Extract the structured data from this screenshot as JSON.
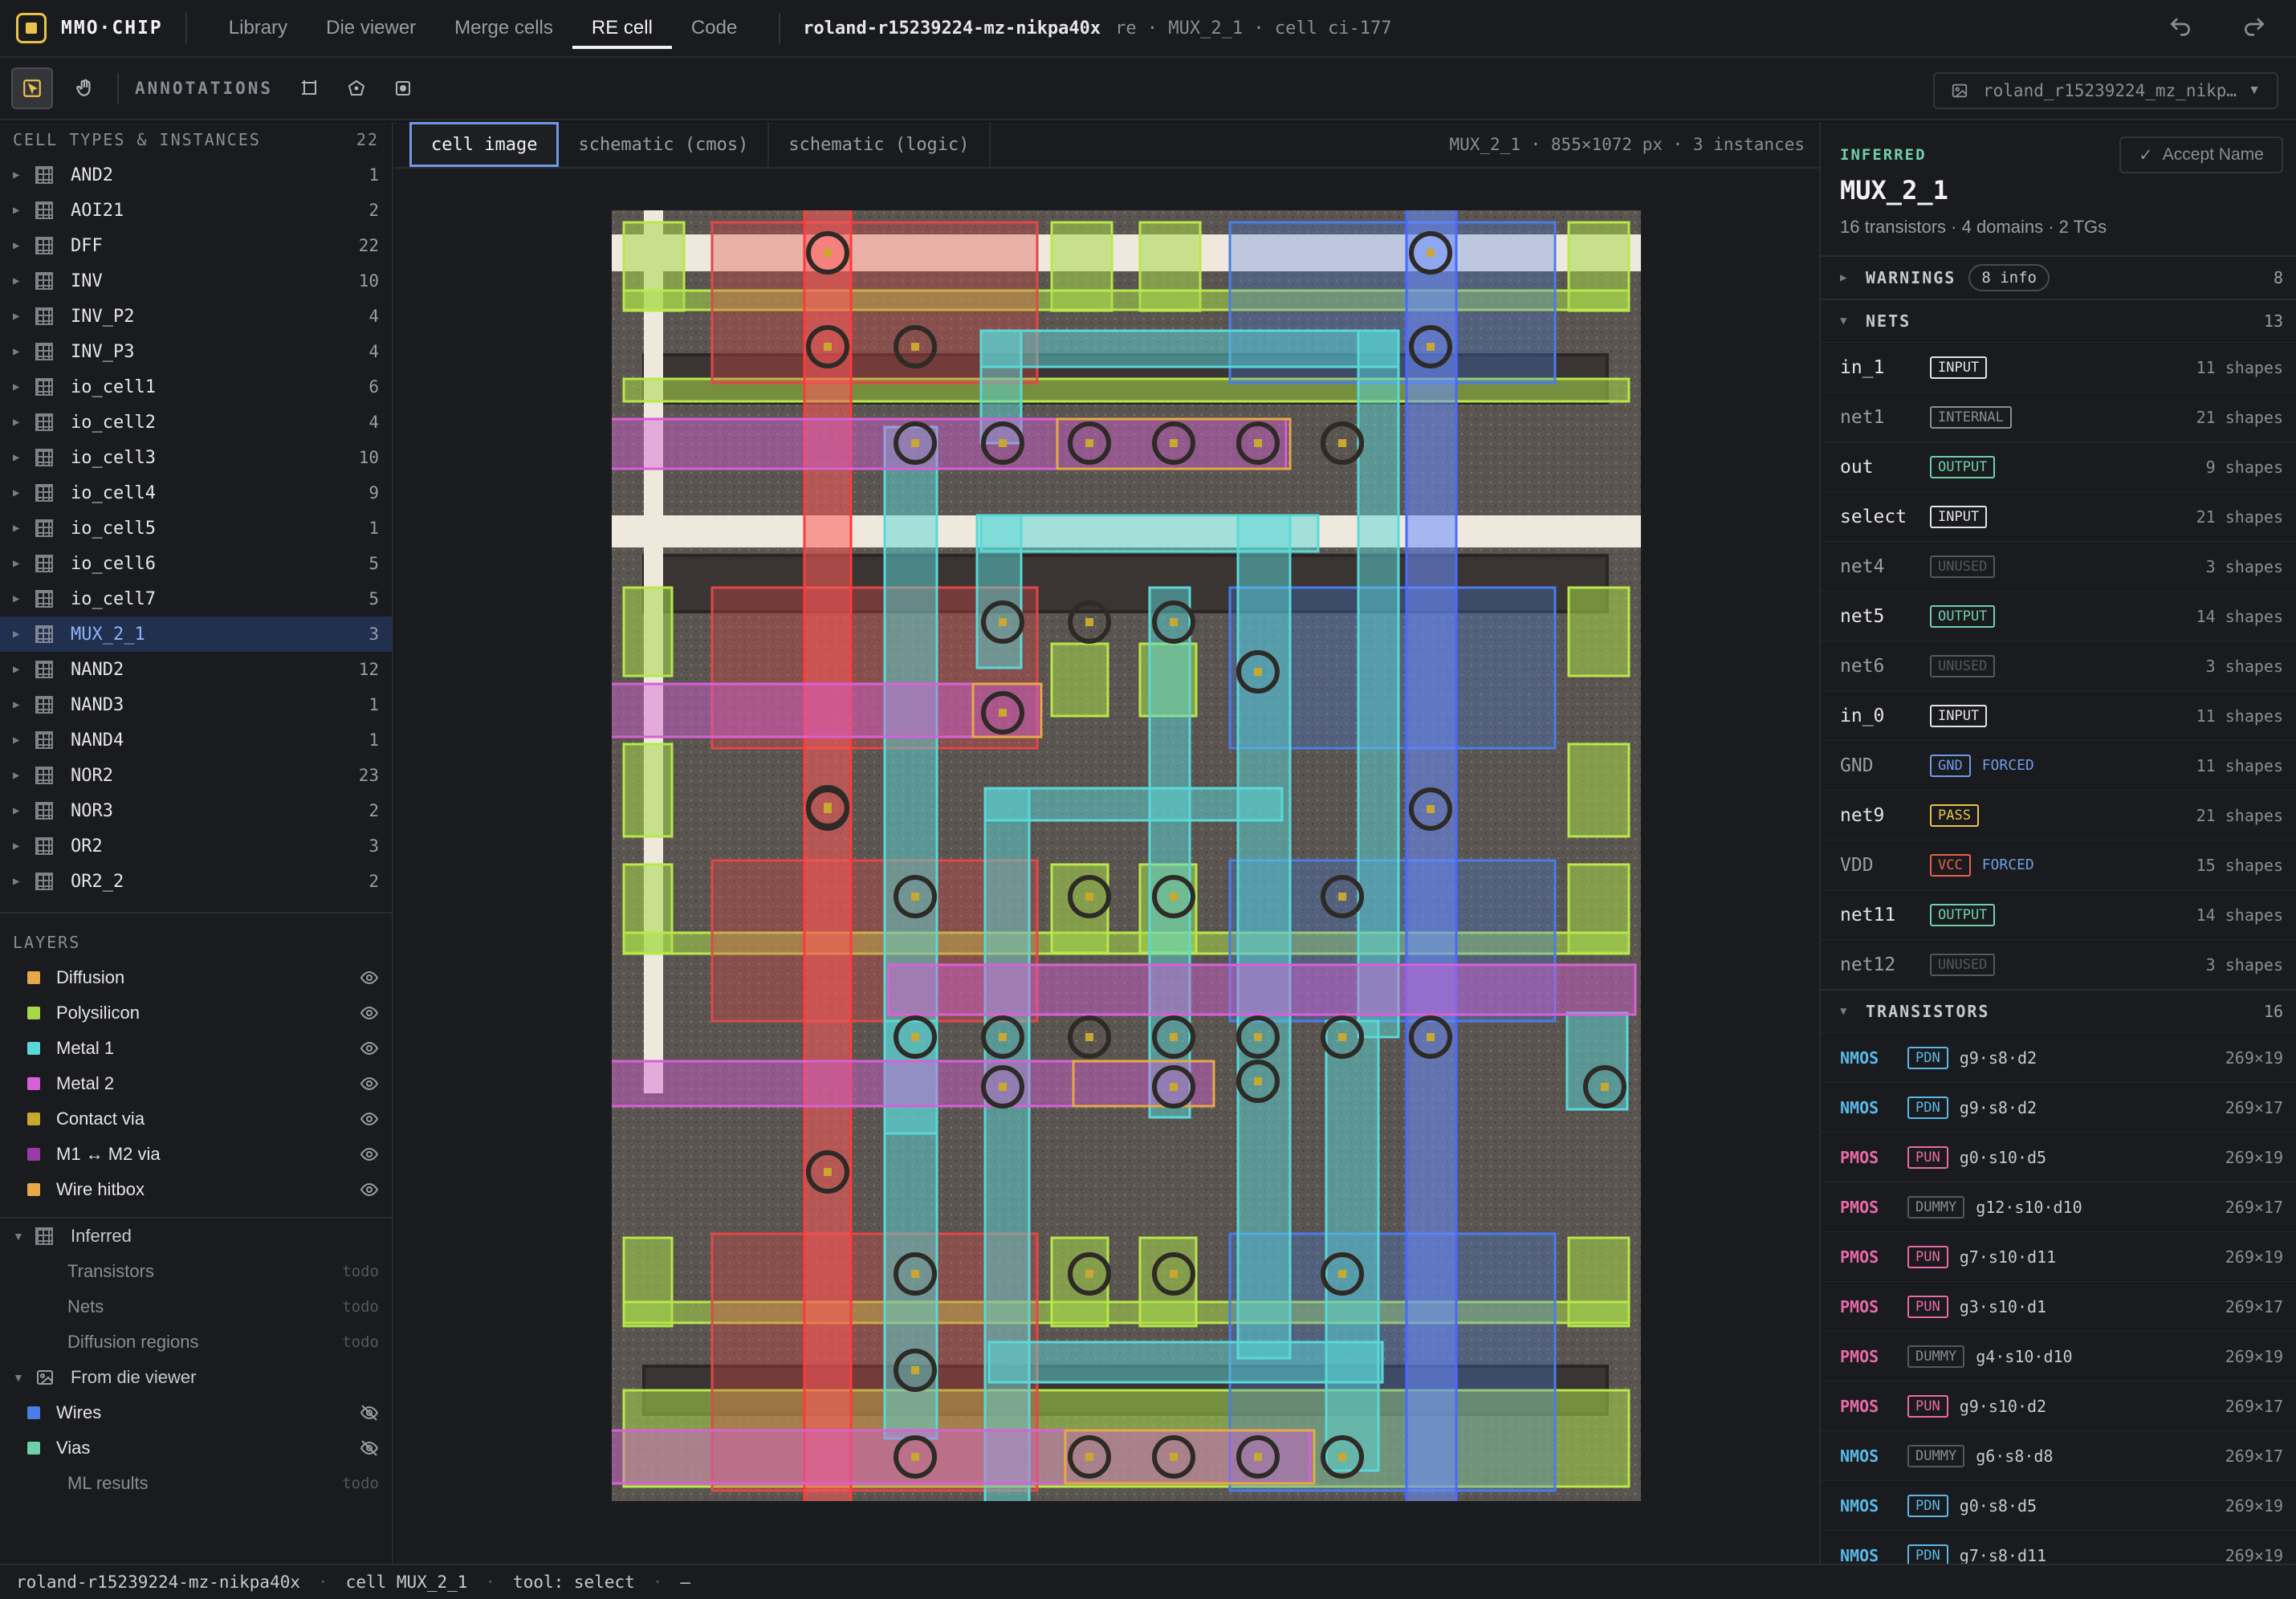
{
  "app": {
    "name": "MMO·CHIP"
  },
  "nav": {
    "tabs": [
      "Library",
      "Die viewer",
      "Merge cells",
      "RE cell",
      "Code"
    ],
    "active": 3
  },
  "breadcrumb": {
    "die": "roland-r15239224-mz-nikpa40x",
    "rest": "re · MUX_2_1 · cell ci-177"
  },
  "toolbar": {
    "annotations_label": "ANNOTATIONS",
    "image_select": "roland_r15239224_mz_nikp…"
  },
  "sidebar": {
    "cells_header": "CELL TYPES & INSTANCES",
    "cells_count": "22",
    "cells": [
      {
        "name": "AND2",
        "count": "1"
      },
      {
        "name": "AOI21",
        "count": "2"
      },
      {
        "name": "DFF",
        "count": "22"
      },
      {
        "name": "INV",
        "count": "10"
      },
      {
        "name": "INV_P2",
        "count": "4"
      },
      {
        "name": "INV_P3",
        "count": "4"
      },
      {
        "name": "io_cell1",
        "count": "6"
      },
      {
        "name": "io_cell2",
        "count": "4"
      },
      {
        "name": "io_cell3",
        "count": "10"
      },
      {
        "name": "io_cell4",
        "count": "9"
      },
      {
        "name": "io_cell5",
        "count": "1"
      },
      {
        "name": "io_cell6",
        "count": "5"
      },
      {
        "name": "io_cell7",
        "count": "5"
      },
      {
        "name": "MUX_2_1",
        "count": "3"
      },
      {
        "name": "NAND2",
        "count": "12"
      },
      {
        "name": "NAND3",
        "count": "1"
      },
      {
        "name": "NAND4",
        "count": "1"
      },
      {
        "name": "NOR2",
        "count": "23"
      },
      {
        "name": "NOR3",
        "count": "2"
      },
      {
        "name": "OR2",
        "count": "3"
      },
      {
        "name": "OR2_2",
        "count": "2"
      }
    ],
    "selected_cell": 13,
    "layers_header": "LAYERS",
    "layers": [
      {
        "name": "Diffusion",
        "color": "#e8a84a"
      },
      {
        "name": "Polysilicon",
        "color": "#a8d84a"
      },
      {
        "name": "Metal 1",
        "color": "#5ad8d8"
      },
      {
        "name": "Metal 2",
        "color": "#d860d8"
      },
      {
        "name": "Contact via",
        "color": "#c8a830"
      },
      {
        "name": "M1 ↔ M2 via",
        "color": "#9a3aa8"
      },
      {
        "name": "Wire hitbox",
        "color": "#e8a84a"
      }
    ],
    "inferred_label": "Inferred",
    "inferred_items": [
      {
        "name": "Transistors",
        "status": "todo"
      },
      {
        "name": "Nets",
        "status": "todo"
      },
      {
        "name": "Diffusion regions",
        "status": "todo"
      }
    ],
    "from_die_label": "From die viewer",
    "die_layers": [
      {
        "name": "Wires",
        "color": "#4a7de8"
      },
      {
        "name": "Vias",
        "color": "#6fd0a8"
      }
    ],
    "ml_results": {
      "name": "ML results",
      "status": "todo"
    }
  },
  "view": {
    "tabs": [
      "cell image",
      "schematic (cmos)",
      "schematic (logic)"
    ],
    "active": 0,
    "meta": "MUX_2_1 · 855×1072 px · 3 instances"
  },
  "panel": {
    "inferred_label": "INFERRED",
    "accept_label": "Accept Name",
    "cell_name": "MUX_2_1",
    "summary": "16 transistors · 4 domains · 2 TGs",
    "warnings_label": "WARNINGS",
    "warnings_pill": "8 info",
    "warnings_count": "8",
    "nets_label": "NETS",
    "nets_count": "13",
    "nets": [
      {
        "name": "in_1",
        "tag": "INPUT",
        "forced": "",
        "shapes": "11 shapes"
      },
      {
        "name": "net1",
        "tag": "INTERNAL",
        "forced": "",
        "shapes": "21 shapes"
      },
      {
        "name": "out",
        "tag": "OUTPUT",
        "forced": "",
        "shapes": "9 shapes"
      },
      {
        "name": "select",
        "tag": "INPUT",
        "forced": "",
        "shapes": "21 shapes"
      },
      {
        "name": "net4",
        "tag": "UNUSED",
        "forced": "",
        "shapes": "3 shapes"
      },
      {
        "name": "net5",
        "tag": "OUTPUT",
        "forced": "",
        "shapes": "14 shapes"
      },
      {
        "name": "net6",
        "tag": "UNUSED",
        "forced": "",
        "shapes": "3 shapes"
      },
      {
        "name": "in_0",
        "tag": "INPUT",
        "forced": "",
        "shapes": "11 shapes"
      },
      {
        "name": "GND",
        "tag": "GND",
        "forced": "FORCED",
        "shapes": "11 shapes"
      },
      {
        "name": "net9",
        "tag": "PASS",
        "forced": "",
        "shapes": "21 shapes"
      },
      {
        "name": "VDD",
        "tag": "VCC",
        "forced": "FORCED",
        "shapes": "15 shapes"
      },
      {
        "name": "net11",
        "tag": "OUTPUT",
        "forced": "",
        "shapes": "14 shapes"
      },
      {
        "name": "net12",
        "tag": "UNUSED",
        "forced": "",
        "shapes": "3 shapes"
      }
    ],
    "tag_colors": {
      "INPUT": "#e4e4e7",
      "INTERNAL": "#8b8d94",
      "OUTPUT": "#6fd0a8",
      "UNUSED": "#55575d",
      "GND": "#6f9ae8",
      "PASS": "#e8c34a",
      "VCC": "#e8604a"
    },
    "transistors_label": "TRANSISTORS",
    "transistors_count": "16",
    "transistors": [
      {
        "type": "NMOS",
        "role": "PDN",
        "terms": "g9·s8·d2",
        "size": "269×19"
      },
      {
        "type": "NMOS",
        "role": "PDN",
        "terms": "g9·s8·d2",
        "size": "269×17"
      },
      {
        "type": "PMOS",
        "role": "PUN",
        "terms": "g0·s10·d5",
        "size": "269×19"
      },
      {
        "type": "PMOS",
        "role": "DUMMY",
        "terms": "g12·s10·d10",
        "size": "269×17"
      },
      {
        "type": "PMOS",
        "role": "PUN",
        "terms": "g7·s10·d11",
        "size": "269×19"
      },
      {
        "type": "PMOS",
        "role": "PUN",
        "terms": "g3·s10·d1",
        "size": "269×17"
      },
      {
        "type": "PMOS",
        "role": "DUMMY",
        "terms": "g4·s10·d10",
        "size": "269×19"
      },
      {
        "type": "PMOS",
        "role": "PUN",
        "terms": "g9·s10·d2",
        "size": "269×17"
      },
      {
        "type": "NMOS",
        "role": "DUMMY",
        "terms": "g6·s8·d8",
        "size": "269×17"
      },
      {
        "type": "NMOS",
        "role": "PDN",
        "terms": "g0·s8·d5",
        "size": "269×19"
      },
      {
        "type": "NMOS",
        "role": "PDN",
        "terms": "g7·s8·d11",
        "size": "269×19"
      }
    ],
    "type_colors": {
      "NMOS": "#5ab8e8",
      "PMOS": "#e86aa8"
    },
    "role_colors": {
      "PDN": "#5ab8e8",
      "PUN": "#e86aa8",
      "DUMMY": "#8b8d94"
    }
  },
  "status": {
    "die": "roland-r15239224-mz-nikpa40x",
    "cell": "cell MUX_2_1",
    "tool": "tool: select",
    "extra": "—"
  }
}
